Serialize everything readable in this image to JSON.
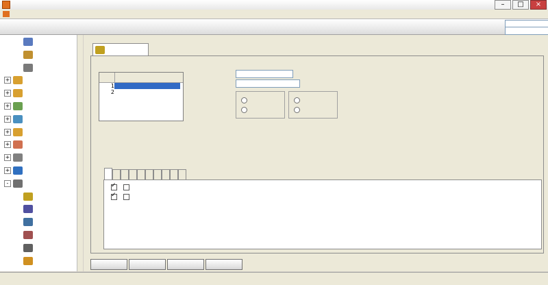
{
  "window": {
    "title": "",
    "min_label": "–",
    "max_label": "□",
    "close_label": "×"
  },
  "menu": {
    "items": [
      "",
      "",
      "",
      ""
    ]
  },
  "header": {
    "module_title": "",
    "plate_label": "",
    "plate_placeholder": "",
    "driver_label": "",
    "driver_placeholder": ""
  },
  "sidebar": {
    "items": [
      {
        "label": "",
        "indent": 2,
        "icon": "car-icon",
        "color": "#5a7abf"
      },
      {
        "label": "",
        "indent": 2,
        "icon": "truck-icon",
        "color": "#c09030"
      },
      {
        "label": "",
        "indent": 2,
        "icon": "person-icon",
        "color": "#7a7a7a"
      },
      {
        "label": "",
        "indent": 1,
        "icon": "folder-icon",
        "color": "#d8a030",
        "expander": "+"
      },
      {
        "label": "",
        "indent": 1,
        "icon": "folder-icon",
        "color": "#d8a030",
        "expander": "+"
      },
      {
        "label": "",
        "indent": 1,
        "icon": "warehouse-icon",
        "color": "#6aa050",
        "expander": "+"
      },
      {
        "label": "",
        "indent": 1,
        "icon": "chart-icon",
        "color": "#4a90c0",
        "expander": "+"
      },
      {
        "label": "",
        "indent": 1,
        "icon": "folder-icon",
        "color": "#d8a030",
        "expander": "+"
      },
      {
        "label": "",
        "indent": 1,
        "icon": "people-icon",
        "color": "#d07050",
        "expander": "+"
      },
      {
        "label": "",
        "indent": 1,
        "icon": "report-icon",
        "color": "#808080",
        "expander": "+"
      },
      {
        "label": "",
        "indent": 1,
        "icon": "gps-icon",
        "color": "#3070c0",
        "expander": "+"
      },
      {
        "label": "",
        "indent": 1,
        "icon": "gear-icon",
        "color": "#707070",
        "expander": "-"
      },
      {
        "label": "",
        "indent": 2,
        "icon": "key-icon",
        "color": "#c0a020"
      },
      {
        "label": "",
        "indent": 2,
        "icon": "password-icon",
        "color": "#5050a0"
      },
      {
        "label": "",
        "indent": 2,
        "icon": "database-backup-icon",
        "color": "#4070a0"
      },
      {
        "label": "",
        "indent": 2,
        "icon": "database-init-icon",
        "color": "#a05050"
      },
      {
        "label": "",
        "indent": 2,
        "icon": "calculator-icon",
        "color": "#606060"
      },
      {
        "label": "",
        "indent": 2,
        "icon": "currency-icon",
        "color": "#d09020"
      }
    ]
  },
  "main": {
    "tab_label": "",
    "table": {
      "headers": [
        "",
        ""
      ],
      "rows": [
        {
          "num": "1",
          "name": ""
        },
        {
          "num": "2",
          "name": ""
        }
      ]
    },
    "operator_name_label": "",
    "operator_name_value": "",
    "operator_password_label": "",
    "operator_password_value": "",
    "quick_label": "",
    "group_enter": {
      "title": "",
      "all_check": "",
      "all_uncheck": ""
    },
    "group_readonly": {
      "title": "",
      "all_check": "",
      "all_uncheck": ""
    },
    "hint": "",
    "tabs": [
      "",
      "",
      "",
      "",
      "",
      "",
      "",
      "",
      "",
      ""
    ],
    "permissions": [
      {
        "label": "",
        "checked": true,
        "readonly_label": ""
      },
      {
        "label": "",
        "checked": true,
        "readonly_label": ""
      }
    ],
    "buttons": {
      "add": "",
      "delete": "",
      "save": "",
      "exit": ""
    }
  },
  "status": {
    "company": "",
    "website": "",
    "phone": "",
    "qq": "",
    "database": "",
    "operator": "",
    "date": ""
  },
  "colors": {
    "accent_red": "#c00000",
    "selection_blue": "#316ac5"
  }
}
